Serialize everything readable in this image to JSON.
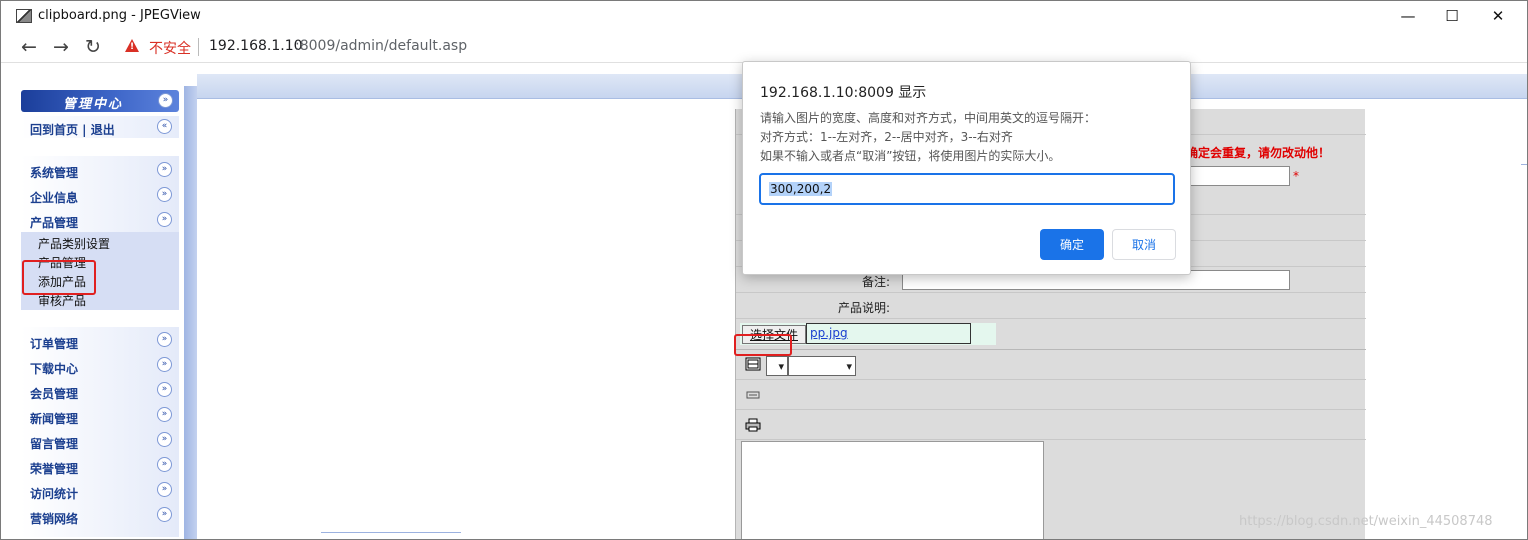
{
  "window": {
    "title": "clipboard.png - JPEGView",
    "minimize_glyph": "—",
    "maximize_glyph": "☐",
    "close_glyph": "✕"
  },
  "addressbar": {
    "back_glyph": "←",
    "forward_glyph": "→",
    "reload_glyph": "↻",
    "security_label": "不安全",
    "url_host": "192.168.1.10",
    "url_rest": ":8009/admin/default.asp",
    "icons": [
      "back-icon",
      "forward-icon",
      "reload-icon",
      "warning-icon"
    ]
  },
  "sidebar": {
    "header_title": "管理中心",
    "home_links": "回到首页 | 退出",
    "groups_top": [
      {
        "label": "系统管理"
      },
      {
        "label": "企业信息"
      },
      {
        "label": "产品管理"
      }
    ],
    "product_subitems": [
      {
        "label": "产品类别设置"
      },
      {
        "label": "产品管理"
      },
      {
        "label": "添加产品"
      },
      {
        "label": "审核产品"
      }
    ],
    "groups_bottom": [
      {
        "label": "订单管理"
      },
      {
        "label": "下载中心"
      },
      {
        "label": "会员管理"
      },
      {
        "label": "新闻管理"
      },
      {
        "label": "留言管理"
      },
      {
        "label": "荣誉管理"
      },
      {
        "label": "访问统计"
      },
      {
        "label": "营销网络"
      }
    ],
    "chevron_glyph": "»",
    "footer_partial": "访问统计"
  },
  "form": {
    "warning": "确定会重复，请勿改动他！",
    "required_mark": "*",
    "note_label": "备注:",
    "description_label": "产品说明:",
    "file_button": "选择文件",
    "file_name": "pp.jpg"
  },
  "dialog": {
    "title": "192.168.1.10:8009 显示",
    "message_lines": [
      "请输入图片的宽度、高度和对齐方式，中间用英文的逗号隔开：",
      "对齐方式：1--左对齐，2--居中对齐，3--右对齐",
      "如果不输入或者点“取消”按钮，将使用图片的实际大小。"
    ],
    "input_value": "300,200,2",
    "ok_label": "确定",
    "cancel_label": "取消"
  },
  "watermark": "https://blog.csdn.net/weixin_44508748",
  "colors": {
    "accent": "#1a73e8",
    "danger": "#e02020",
    "sidebar_blue": "#1b3f8f",
    "menu_header": "#2b55b8"
  }
}
